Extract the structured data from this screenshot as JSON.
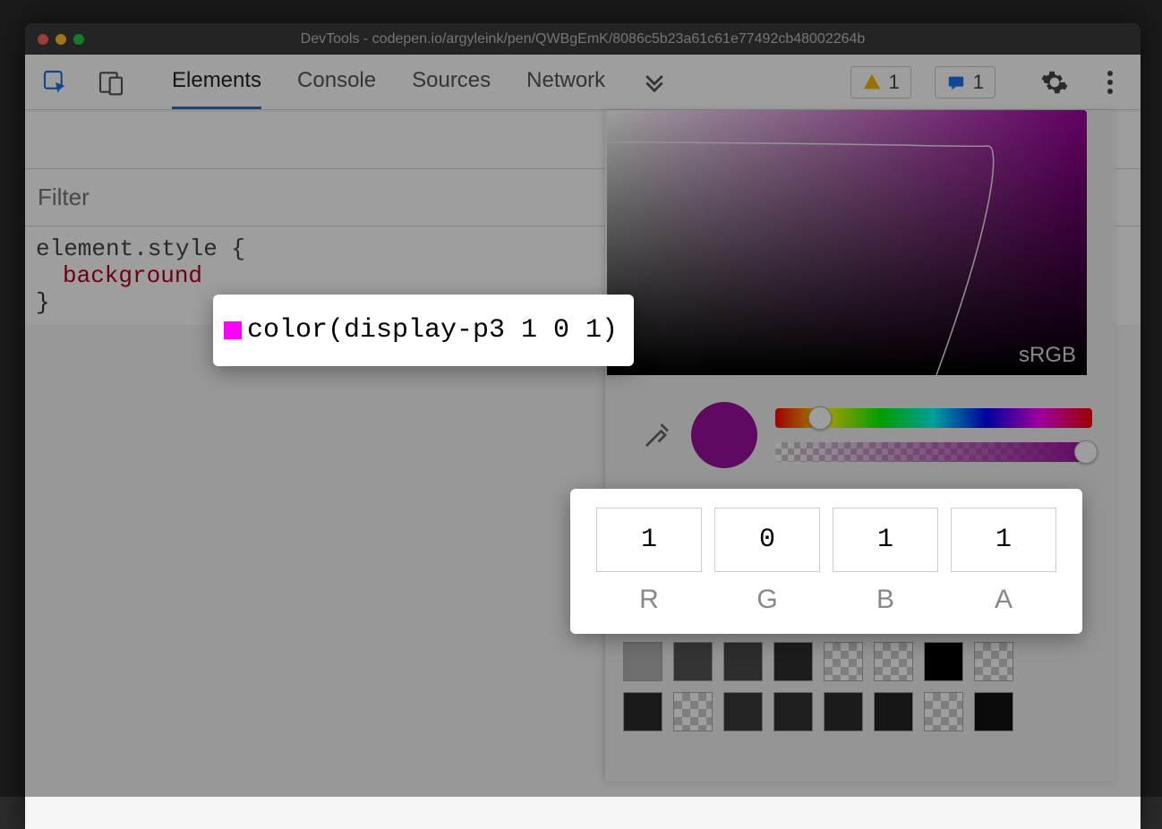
{
  "window": {
    "title": "DevTools - codepen.io/argyleink/pen/QWBgEmK/8086c5b23a61c61e77492cb48002264b"
  },
  "toolbar": {
    "tabs": [
      "Elements",
      "Console",
      "Sources",
      "Network"
    ],
    "active_tab": "Elements",
    "warnings_count": "1",
    "messages_count": "1"
  },
  "styles": {
    "filter_placeholder": "Filter",
    "selector": "element.style {",
    "property": "background",
    "value_text": "color(display-p3 1 0 1)",
    "close": "}"
  },
  "picker": {
    "gamut_label": "sRGB",
    "eyedrop_name": "eyedropper-icon",
    "swatch_color": "#9c0fa0",
    "channels": {
      "R": "1",
      "G": "0",
      "B": "1",
      "A": "1"
    },
    "palette": [
      "#8f8fe0",
      "#000000",
      "#1f1f1f",
      "#d8c400",
      "#c9a400",
      "#ffffff",
      "#ffffff",
      "#9c9c9c",
      "#b3b3b3",
      "#555555",
      "#4a4a4a",
      "#2e2e2e",
      "chk",
      "chk",
      "#000000",
      "chk",
      "#2a2a2a",
      "chk",
      "#3a3a3a",
      "#313131",
      "#2c2c2c",
      "#252525",
      "chk",
      "#111111"
    ]
  }
}
